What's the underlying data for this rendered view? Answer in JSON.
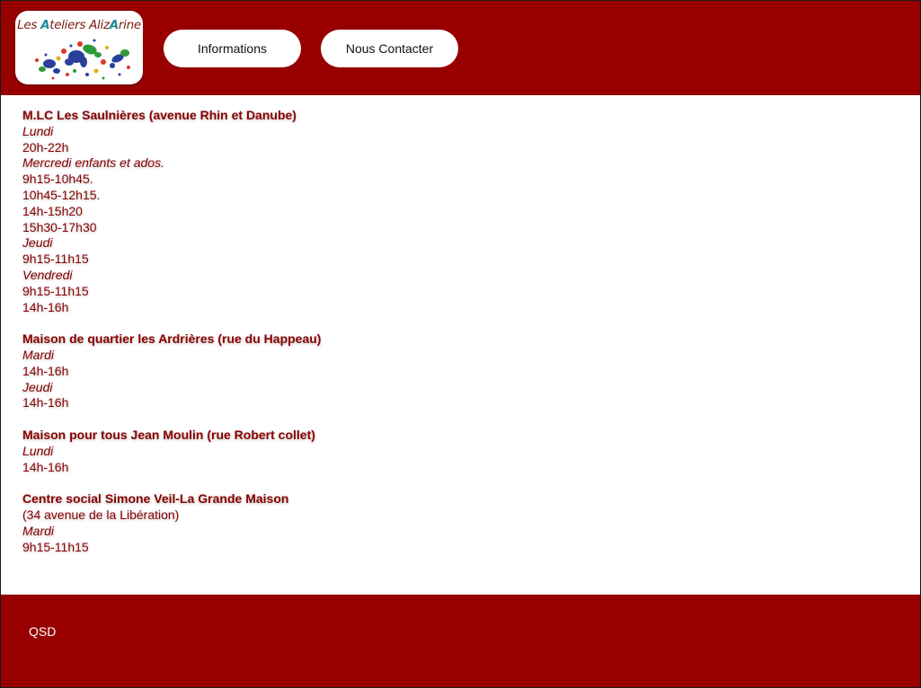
{
  "logo": {
    "part1": "Les ",
    "cap1": "A",
    "part2": "teliers Aliz",
    "cap2": "A",
    "part3": "rine"
  },
  "nav": {
    "informations": "Informations",
    "contact": "Nous Contacter"
  },
  "colors": {
    "brand_red": "#980000",
    "text_red": "#8a0000"
  },
  "venues": [
    {
      "title": "M.LC Les Saulnières (avenue Rhin et Danube)",
      "lines": [
        {
          "t": "Lundi",
          "day": true
        },
        {
          "t": "20h-22h"
        },
        {
          "t": "Mercredi enfants et ados.",
          "day": true
        },
        {
          "t": "9h15-10h45."
        },
        {
          "t": "10h45-12h15."
        },
        {
          "t": "14h-15h20"
        },
        {
          "t": "15h30-17h30"
        },
        {
          "t": "Jeudi",
          "day": true
        },
        {
          "t": "9h15-11h15"
        },
        {
          "t": "Vendredi",
          "day": true
        },
        {
          "t": "9h15-11h15"
        },
        {
          "t": "14h-16h"
        }
      ]
    },
    {
      "title": "Maison de quartier les Ardrières (rue du Happeau)",
      "lines": [
        {
          "t": "Mardi",
          "day": true
        },
        {
          "t": "14h-16h"
        },
        {
          "t": "Jeudi",
          "day": true
        },
        {
          "t": "14h-16h"
        }
      ]
    },
    {
      "title": "Maison pour tous Jean Moulin (rue Robert collet)",
      "lines": [
        {
          "t": "Lundi",
          "day": true
        },
        {
          "t": "14h-16h"
        }
      ]
    },
    {
      "title": "Centre social Simone Veil-La Grande Maison",
      "lines": [
        {
          "t": "(34 avenue de la Libération)"
        },
        {
          "t": "Mardi",
          "day": true
        },
        {
          "t": "9h15-11h15"
        }
      ]
    }
  ],
  "footer": {
    "text": "QSD"
  }
}
